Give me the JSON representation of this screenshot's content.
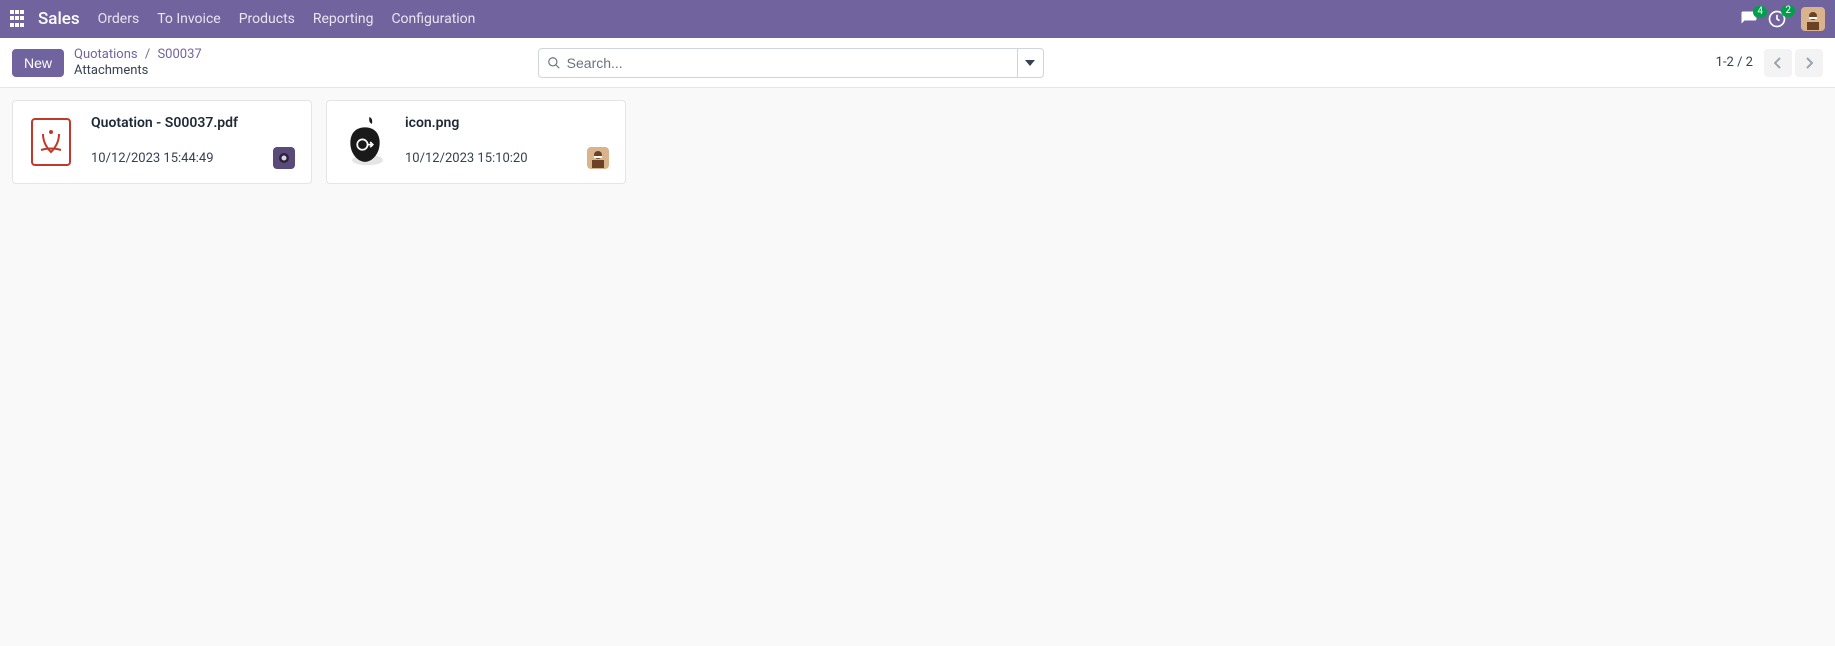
{
  "nav": {
    "app_title": "Sales",
    "menu": [
      "Orders",
      "To Invoice",
      "Products",
      "Reporting",
      "Configuration"
    ],
    "messages_badge": "4",
    "activities_badge": "2"
  },
  "controls": {
    "new_button": "New",
    "breadcrumb": {
      "root": "Quotations",
      "sep": "/",
      "id": "S00037",
      "sub": "Attachments"
    },
    "search_placeholder": "Search...",
    "pager": "1-2 / 2"
  },
  "attachments": [
    {
      "title": "Quotation - S00037.pdf",
      "date": "10/12/2023 15:44:49",
      "kind": "pdf",
      "uploader_avatar": "camera"
    },
    {
      "title": "icon.png",
      "date": "10/12/2023 15:10:20",
      "kind": "apple",
      "uploader_avatar": "user"
    }
  ]
}
